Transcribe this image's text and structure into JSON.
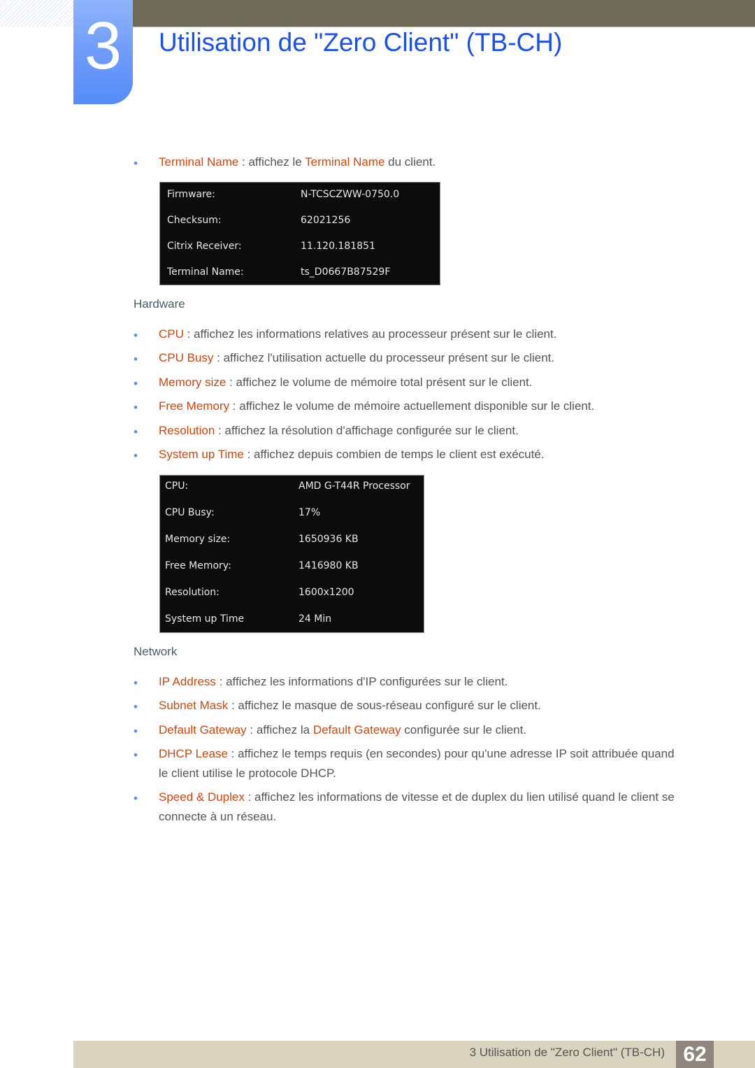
{
  "header": {
    "chapter_number": "3",
    "title": "Utilisation de \"Zero Client\" (TB-CH)"
  },
  "terminal_item": {
    "kw1": "Terminal Name",
    "sep": " : affichez le ",
    "kw2": "Terminal Name",
    "rest": " du client."
  },
  "firmware_panel": {
    "rows": [
      {
        "label": "Firmware:",
        "value": "N-TCSCZWW-0750.0"
      },
      {
        "label": "Checksum:",
        "value": "62021256"
      },
      {
        "label": "Citrix Receiver:",
        "value": "11.120.181851"
      },
      {
        "label": "Terminal Name:",
        "value": "ts_D0667B87529F"
      }
    ]
  },
  "hardware": {
    "heading": "Hardware",
    "items": [
      {
        "kw": "CPU",
        "text": " : affichez les informations relatives au processeur présent sur le client."
      },
      {
        "kw": "CPU Busy",
        "text": " : affichez l'utilisation actuelle du processeur présent sur le client."
      },
      {
        "kw": "Memory size",
        "text": " : affichez le volume de mémoire total présent sur le client."
      },
      {
        "kw": "Free Memory",
        "text": " : affichez le volume de mémoire actuellement disponible sur le client."
      },
      {
        "kw": "Resolution",
        "text": " : affichez la résolution d'affichage configurée sur le client."
      },
      {
        "kw": "System up Time",
        "text": " : affichez depuis combien de temps le client est exécuté."
      }
    ]
  },
  "hardware_panel": {
    "rows": [
      {
        "label": "CPU:",
        "value": "AMD G-T44R Processor"
      },
      {
        "label": "CPU Busy:",
        "value": "17%"
      },
      {
        "label": "Memory size:",
        "value": "1650936 KB"
      },
      {
        "label": "Free Memory:",
        "value": "1416980 KB"
      },
      {
        "label": "Resolution:",
        "value": "1600x1200"
      },
      {
        "label": "System up Time",
        "value": "24 Min"
      }
    ]
  },
  "network": {
    "heading": "Network",
    "items": [
      {
        "kw": "IP Address",
        "text": " : affichez les informations d'IP configurées sur le client."
      },
      {
        "kw": "Subnet Mask",
        "text": " : affichez le masque de sous-réseau configuré sur le client."
      },
      {
        "kw": "Default Gateway",
        "text": " : affichez la ",
        "kw2": "Default Gateway",
        "text2": " configurée sur le client."
      },
      {
        "kw": "DHCP Lease",
        "text": " : affichez le temps requis (en secondes) pour qu'une adresse IP soit attribuée quand",
        "cont": "le client utilise le protocole DHCP."
      },
      {
        "kw": "Speed & Duplex",
        "text": " : affichez les informations de vitesse et de duplex du lien utilisé quand le client se",
        "cont": "connecte à un réseau."
      }
    ]
  },
  "footer": {
    "text": "3 Utilisation de \"Zero Client\" (TB-CH)",
    "page_number": "62"
  }
}
